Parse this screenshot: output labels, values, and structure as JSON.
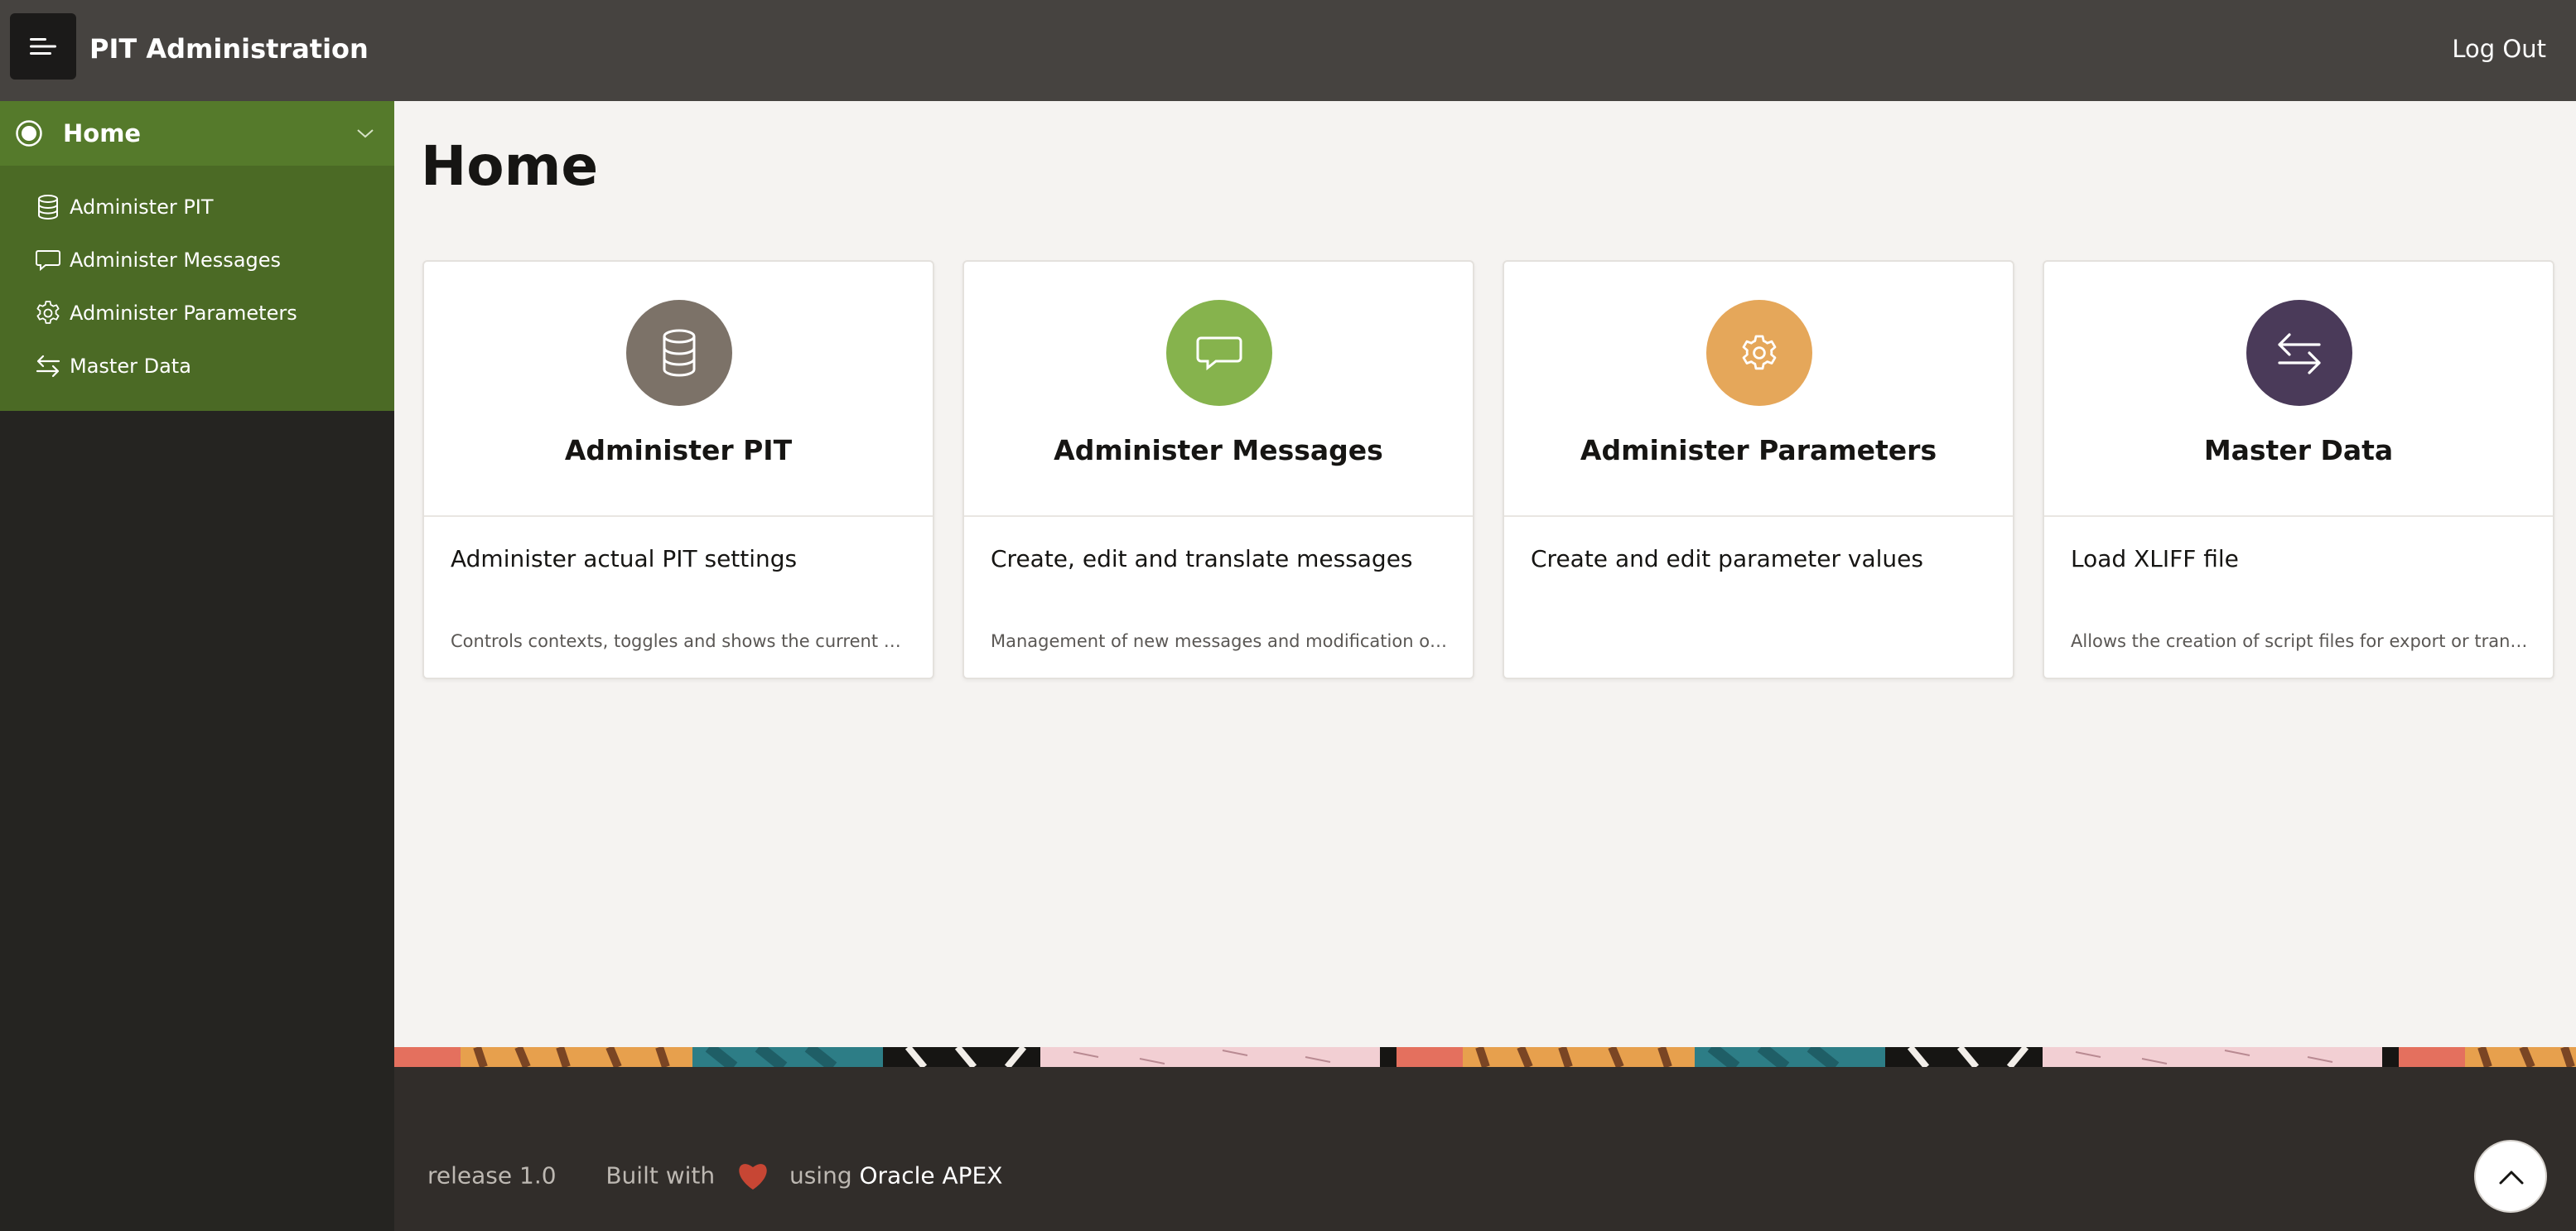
{
  "header": {
    "app_title": "PIT Administration",
    "logout_label": "Log Out",
    "menu_icon": "hamburger-menu-icon"
  },
  "sidebar": {
    "home_label": "Home",
    "items": [
      {
        "label": "Administer PIT",
        "icon": "database-icon"
      },
      {
        "label": "Administer Messages",
        "icon": "speech-bubble-icon"
      },
      {
        "label": "Administer Parameters",
        "icon": "gear-icon"
      },
      {
        "label": "Master Data",
        "icon": "arrows-exchange-icon"
      }
    ]
  },
  "main": {
    "page_title": "Home",
    "cards": [
      {
        "title": "Administer PIT",
        "subtitle": "Administer actual PIT settings",
        "description": "Controls contexts, toggles and shows the current parameters",
        "icon": "database-icon",
        "color": "#7c7268"
      },
      {
        "title": "Administer Messages",
        "subtitle": "Create, edit and translate messages",
        "description": "Management of new messages and modification of existing messages",
        "icon": "speech-bubble-icon",
        "color": "#86b34d"
      },
      {
        "title": "Administer Parameters",
        "subtitle": "Create and edit parameter values",
        "description": "",
        "icon": "gear-icon",
        "color": "#e5a75a"
      },
      {
        "title": "Master Data",
        "subtitle": "Load XLIFF file",
        "description": "Allows the creation of script files for export or translation",
        "icon": "arrows-exchange-icon",
        "color": "#4a3a59"
      }
    ]
  },
  "footer": {
    "release": "release 1.0",
    "built_with": "Built with",
    "using": "using",
    "apex_link": "Oracle APEX"
  },
  "colors": {
    "header_bg": "#464340",
    "sidebar_bg": "#252421",
    "nav_active": "#557a2b",
    "nav_group": "#4b6a25",
    "heart": "#c74634"
  }
}
